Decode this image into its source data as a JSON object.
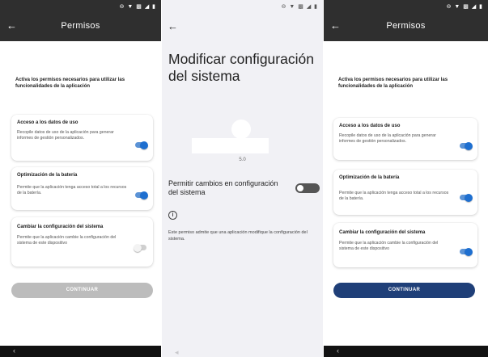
{
  "screens": [
    {
      "status_icons": "⊖ ▼ ▩ ◢ ▮",
      "back_icon": "←",
      "title": "Permisos",
      "intro": "Activa los permisos necesarios para utilizar las funcionalidades de la aplicación",
      "cards": [
        {
          "title": "Acceso a los datos de uso",
          "description": "Recopile datos de uso de la aplicación para generar informes de gestión personalizados.",
          "toggle_on": true
        },
        {
          "title": "Optimización de la batería",
          "description": "Permite que la aplicación tenga acceso total a los recursos de la batería.",
          "toggle_on": true
        },
        {
          "title": "Cambiar la configuración del sistema",
          "description": "Permite que la aplicación cambie la configuración del sistema de este dispositivo",
          "toggle_on": false
        }
      ],
      "button_label": "CONTINUAR",
      "button_enabled": false,
      "nav_back": "‹"
    },
    {
      "status_icons": "⊖ ▼ ▩ ◢ ▮",
      "back_icon": "←",
      "heading": "Modificar configuración del sistema",
      "version": "5.0",
      "switch_label": "Permitir cambios en configuración del sistema",
      "switch_on": false,
      "info_icon": "i",
      "note": "Este permiso admite que una aplicación modifique la configuración del sistema.",
      "nav_back": "◂"
    },
    {
      "status_icons": "⊖ ▼ ▩ ◢ ▮",
      "back_icon": "←",
      "title": "Permisos",
      "intro": "Activa los permisos necesarios para utilizar las funcionalidades de la aplicación",
      "cards": [
        {
          "title": "Acceso a los datos de uso",
          "description": "Recopile datos de uso de la aplicación para generar informes de gestión personalizados.",
          "toggle_on": true
        },
        {
          "title": "Optimización de la batería",
          "description": "Permite que la aplicación tenga acceso total a los recursos de la batería.",
          "toggle_on": true
        },
        {
          "title": "Cambiar la configuración del sistema",
          "description": "Permite que la aplicación cambie la configuración del sistema de este dispositivo",
          "toggle_on": true
        }
      ],
      "button_label": "CONTINUAR",
      "button_enabled": true,
      "nav_back": "‹"
    }
  ],
  "colors": {
    "appbar": "#2f2f2f",
    "toggle_on": "#1e6fd0",
    "button_enabled": "#1f3f78",
    "button_disabled": "#bcbcbc",
    "settings_background": "#f1f1f5"
  }
}
